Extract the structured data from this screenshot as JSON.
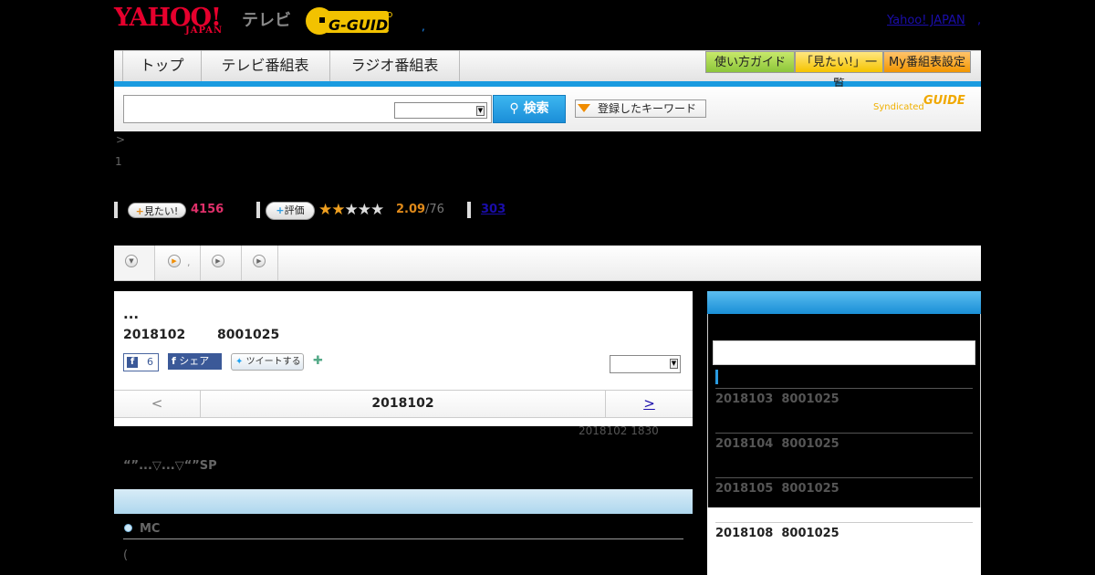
{
  "header": {
    "brand_yahoo": "YAHOO!",
    "brand_japan": "JAPAN",
    "brand_tv": "テレビ",
    "brand_gguide": "G-GUIDE",
    "separator": ",",
    "yahoo_japan_link": "Yahoo! JAPAN",
    "link_separator": ","
  },
  "nav": {
    "tabs": [
      "トップ",
      "テレビ番組表",
      "ラジオ番組表"
    ],
    "guide_buttons": [
      "使い方ガイド",
      "「見たい!」一覧",
      "My番組表設定"
    ]
  },
  "search": {
    "input_value": "",
    "select_value": "",
    "search_label": "検索",
    "keyword_label": "登録したキーワード",
    "syndicated_label": "Syndicated",
    "syndicated_logo": "GUIDE"
  },
  "breadcrumb": {
    "arrow": ">",
    "number": "1"
  },
  "stats": {
    "mitai_label": "見たい!",
    "mitai_count": "4156",
    "hyoka_label": "評価",
    "stars_filled": "★★",
    "stars_empty": "★★★",
    "rating": "2.09",
    "rating_count": "/76",
    "review_count": "303"
  },
  "tabstrip": {
    "items": [
      "",
      ",",
      "",
      ""
    ]
  },
  "program": {
    "title": "...",
    "date": "2018102",
    "channel": "8001025",
    "fb_like_count": "6",
    "fb_share_label": "シェア",
    "tweet_label": "ツイートする",
    "select_value": "",
    "prev_label": "<",
    "nav_date": "2018102",
    "next_label": ">",
    "airtime": "2018102  1830",
    "subtitle": "“”...▽...▽“”SP",
    "mc_label": "MC",
    "paren": "("
  },
  "sidebar": {
    "items": [
      {
        "date": "2018103",
        "channel": "8001025"
      },
      {
        "date": "2018104",
        "channel": "8001025"
      },
      {
        "date": "2018105",
        "channel": "8001025"
      },
      {
        "date": "2018108",
        "channel": "8001025"
      }
    ]
  },
  "colors": {
    "accent_blue": "#1a9be0",
    "brand_red": "#e6002d",
    "mitai_pink": "#e0306a",
    "rating_orange": "#e08a1a",
    "gguide_yellow": "#f0c000"
  }
}
